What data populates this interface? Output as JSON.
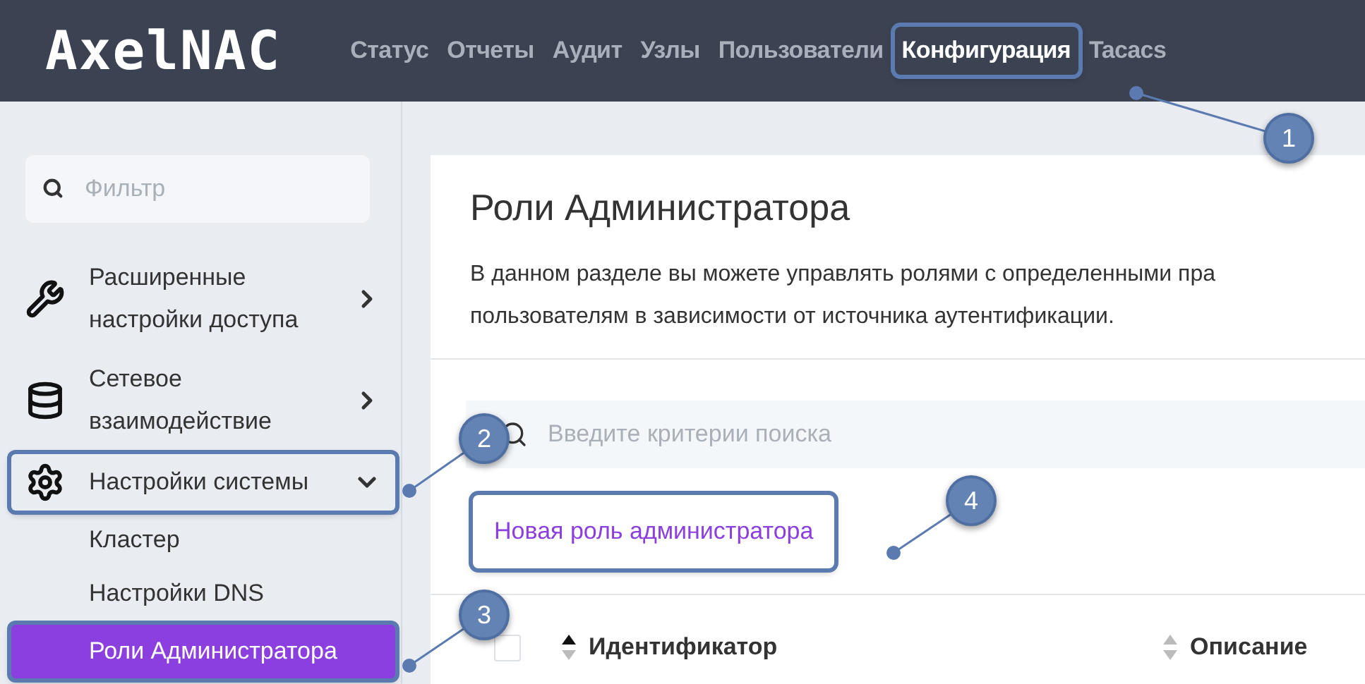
{
  "app": {
    "logo": "AxelNAC"
  },
  "nav": [
    {
      "label": "Статус",
      "selected": false,
      "outlined": false
    },
    {
      "label": "Отчеты",
      "selected": false,
      "outlined": false
    },
    {
      "label": "Аудит",
      "selected": false,
      "outlined": false
    },
    {
      "label": "Узлы",
      "selected": false,
      "outlined": false
    },
    {
      "label": "Пользователи",
      "selected": false,
      "outlined": false
    },
    {
      "label": "Конфигурация",
      "selected": true,
      "outlined": true
    },
    {
      "label": "Tacacs",
      "selected": false,
      "outlined": false
    }
  ],
  "sidebar": {
    "filter": {
      "placeholder": "Фильтр"
    },
    "items": [
      {
        "label": "Расширенные настройки доступа",
        "expanded": false,
        "outlined": false
      },
      {
        "label": "Сетевое взаимодействие",
        "expanded": false,
        "outlined": false
      },
      {
        "label": "Настройки системы",
        "expanded": true,
        "outlined": true,
        "children": [
          {
            "label": "Кластер",
            "selected": false,
            "outlined": false
          },
          {
            "label": "Настройки DNS",
            "selected": false,
            "outlined": false
          },
          {
            "label": "Роли Администратора",
            "selected": true,
            "outlined": true
          }
        ]
      }
    ]
  },
  "main": {
    "title": "Роли Администратора",
    "description": [
      "В данном разделе вы можете управлять ролями с определенными пра",
      "пользователям в зависимости от источника аутентификации."
    ],
    "search": {
      "placeholder": "Введите критерии поиска"
    },
    "new_button": {
      "label": "Новая роль администратора",
      "outlined": true
    },
    "table": {
      "select_all": {
        "checked": false
      },
      "columns": [
        {
          "label": "Идентификатор",
          "sorted": true
        },
        {
          "label": "Описание",
          "sorted": false
        }
      ]
    }
  },
  "annotations": [
    {
      "number": "1"
    },
    {
      "number": "2"
    },
    {
      "number": "3"
    },
    {
      "number": "4"
    }
  ]
}
